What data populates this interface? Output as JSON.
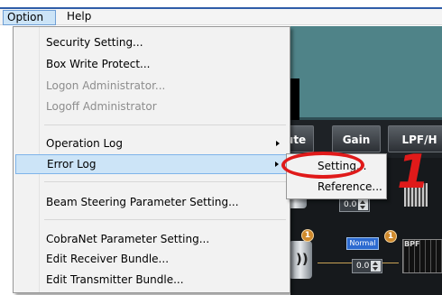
{
  "menubar": {
    "items": [
      {
        "label": "Option",
        "open": true
      },
      {
        "label": "Help",
        "open": false
      }
    ]
  },
  "option_menu": {
    "items": [
      {
        "label": "Security Setting...",
        "enabled": true
      },
      {
        "label": "Box Write Protect...",
        "enabled": true
      },
      {
        "label": "Logon Administrator...",
        "enabled": false
      },
      {
        "label": "Logoff Administrator",
        "enabled": false
      },
      {
        "label": "Operation Log",
        "enabled": true,
        "submenu": true
      },
      {
        "label": "Error Log",
        "enabled": true,
        "submenu": true,
        "highlighted": true
      },
      {
        "label": "Beam Steering Parameter Setting...",
        "enabled": true
      },
      {
        "label": "CobraNet Parameter Setting...",
        "enabled": true
      },
      {
        "label": "Edit Receiver Bundle...",
        "enabled": true
      },
      {
        "label": "Edit Transmitter Bundle...",
        "enabled": true
      }
    ]
  },
  "error_log_submenu": {
    "items": [
      {
        "label": "Setting..."
      },
      {
        "label": "Reference..."
      }
    ]
  },
  "background_app": {
    "headers": [
      "ute",
      "Gain",
      "LPF/H"
    ],
    "gain_values": [
      "0.0",
      "0.0"
    ],
    "normal_button": "Normal",
    "badges": [
      "1",
      "1",
      "1"
    ],
    "filter_label": "BPF"
  },
  "annotation": {
    "callout_number": "1",
    "color": "#e01a1a"
  },
  "colors": {
    "menu_highlight": "#cce4f7",
    "menu_highlight_border": "#7eb4ea",
    "title_bar_blue": "#2f5da8",
    "app_teal": "#4f8388"
  }
}
